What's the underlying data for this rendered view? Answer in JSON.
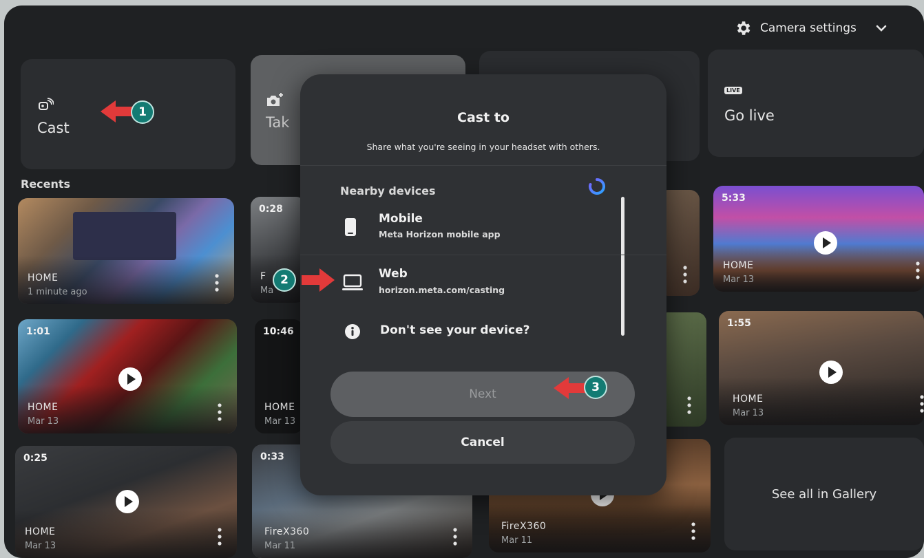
{
  "header": {
    "camera_settings_label": "Camera settings"
  },
  "actions": {
    "cast_label": "Cast",
    "take_label": "Tak",
    "golive_label": "Go live",
    "live_badge": "LIVE"
  },
  "recents": {
    "title": "Recents",
    "tiles": [
      {
        "duration": "",
        "app": "HOME",
        "date": "1 minute ago"
      },
      {
        "duration": "0:28",
        "app": "F",
        "date": "Ma"
      },
      {
        "duration": "5:33",
        "app": "HOME",
        "date": "Mar 13"
      },
      {
        "duration": "1:01",
        "app": "HOME",
        "date": "Mar 13"
      },
      {
        "duration": "10:46",
        "app": "HOME",
        "date": "Mar 13"
      },
      {
        "duration": "1:55",
        "app": "HOME",
        "date": "Mar 13"
      },
      {
        "duration": "0:25",
        "app": "HOME",
        "date": "Mar 13"
      },
      {
        "duration": "0:33",
        "app": "FireX360",
        "date": "Mar 11"
      },
      {
        "duration": "",
        "app": "FireX360",
        "date": "Mar 11"
      }
    ],
    "see_all_label": "See all in Gallery"
  },
  "dialog": {
    "title": "Cast to",
    "subtitle": "Share what you're seeing in your headset with others.",
    "nearby_label": "Nearby devices",
    "devices": [
      {
        "name": "Mobile",
        "sub": "Meta Horizon mobile app",
        "icon": "phone-icon"
      },
      {
        "name": "Web",
        "sub": "horizon.meta.com/casting",
        "icon": "laptop-icon"
      }
    ],
    "help_label": "Don't see your device?",
    "next_label": "Next",
    "cancel_label": "Cancel"
  },
  "annotations": {
    "badge1": "1",
    "badge2": "2",
    "badge3": "3"
  },
  "colors": {
    "badge": "#137b73",
    "arrow": "#e23a3a",
    "panel": "#1f2123",
    "dialog": "#2f3134"
  }
}
